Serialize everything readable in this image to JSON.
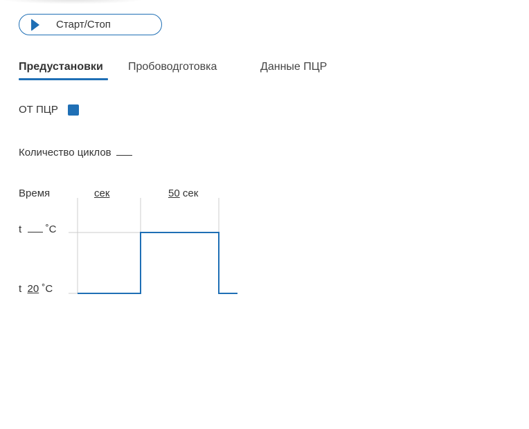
{
  "toolbar": {
    "start_stop_label": "Старт/Стоп"
  },
  "tabs": [
    {
      "label": "Предустановки",
      "active": true
    },
    {
      "label": "Пробоводготовка",
      "active": false
    },
    {
      "label": "Данные ПЦР",
      "active": false
    }
  ],
  "ot_pcr": {
    "label": "ОТ ПЦР",
    "checked": true
  },
  "cycles": {
    "label": "Количество циклов",
    "value": ""
  },
  "time_row": {
    "label": "Время",
    "step1": {
      "value": "",
      "unit": "сек"
    },
    "step2": {
      "value": "50",
      "unit": "сек"
    }
  },
  "temps": {
    "high": {
      "prefix": "t",
      "value": "",
      "unit": "˚C"
    },
    "low": {
      "prefix": "t",
      "value": "20",
      "unit": "˚C"
    }
  },
  "colors": {
    "accent": "#1f6fb5",
    "grid": "#cccccc"
  }
}
